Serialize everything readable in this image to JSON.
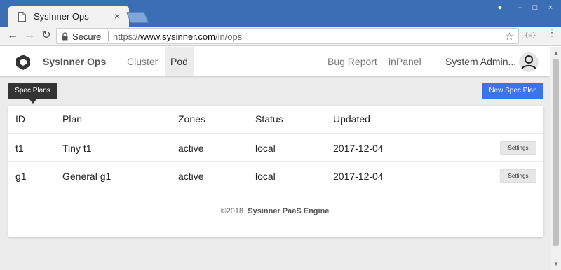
{
  "browser": {
    "tab_title": "SysInner Ops",
    "tab_close": "×",
    "window_controls": {
      "user": "●",
      "minimize": "–",
      "maximize": "□",
      "close": "×"
    },
    "nav": {
      "back": "←",
      "forward": "→",
      "reload": "↻"
    },
    "secure_label": "Secure",
    "url_prefix": "https://",
    "url_host": "www.sysinner.com",
    "url_path": "/in/ops",
    "bookmark_icon": "☆",
    "extension_label": "{≡}",
    "menu_icon": "⋮"
  },
  "navbar": {
    "brand": "SysInner Ops",
    "items": [
      {
        "label": "Cluster",
        "active": false
      },
      {
        "label": "Pod",
        "active": true
      }
    ],
    "right_items": [
      {
        "label": "Bug Report"
      },
      {
        "label": "inPanel"
      },
      {
        "label": "System Admin..."
      }
    ]
  },
  "tooltip": "Spec Plans",
  "new_button": "New Spec Plan",
  "table": {
    "columns": [
      "ID",
      "Plan",
      "Zones",
      "Status",
      "Updated"
    ],
    "rows": [
      {
        "id": "t1",
        "plan": "Tiny t1",
        "zones": "active",
        "status": "local",
        "updated": "2017-12-04",
        "action": "Settings"
      },
      {
        "id": "g1",
        "plan": "General g1",
        "zones": "active",
        "status": "local",
        "updated": "2017-12-04",
        "action": "Settings"
      }
    ]
  },
  "footer": {
    "copyright": "©2018",
    "engine": "Sysinner PaaS Engine"
  },
  "colors": {
    "titlebar": "#3a6fb5",
    "primary_button": "#3a74e8",
    "page_background": "#ececec"
  }
}
